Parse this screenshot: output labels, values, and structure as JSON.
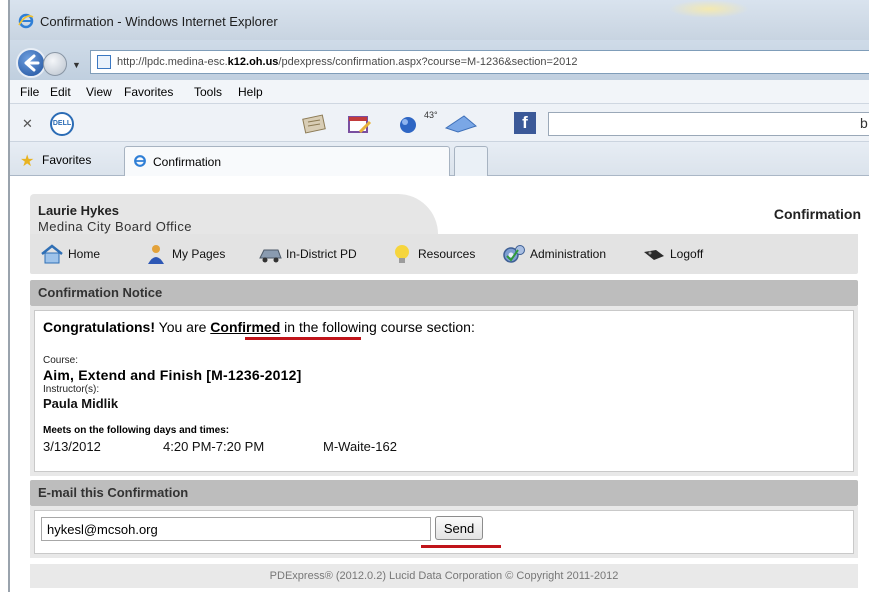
{
  "browser": {
    "window_title": "Confirmation - Windows Internet Explorer",
    "address_pre": "http://lpdc.medina-esc.",
    "address_bold": "k12.oh.us",
    "address_post": "/pdexpress/confirmation.aspx?course=M-1236&section=2012",
    "menu": [
      "File",
      "Edit",
      "View",
      "Favorites",
      "Tools",
      "Help"
    ],
    "weather_temp": "43°",
    "search_partial": "b",
    "favorites_label": "Favorites",
    "tab_label": "Confirmation"
  },
  "header": {
    "user_name": "Laurie Hykes",
    "organization": "Medina City Board Office",
    "page_title": "Confirmation"
  },
  "nav": {
    "items": [
      {
        "label": "Home",
        "icon": "home-icon"
      },
      {
        "label": "My Pages",
        "icon": "person-icon"
      },
      {
        "label": "In-District PD",
        "icon": "vehicle-icon"
      },
      {
        "label": "Resources",
        "icon": "lightbulb-icon"
      },
      {
        "label": "Administration",
        "icon": "gears-icon"
      },
      {
        "label": "Logoff",
        "icon": "logoff-icon"
      }
    ]
  },
  "notice": {
    "heading": "Confirmation Notice",
    "congrats_bold": "Congratulations!",
    "text_pre": " You are ",
    "confirmed": "Confirmed",
    "text_post": " in the following course section:",
    "course_label": "Course:",
    "course_name": "Aim, Extend and Finish [M-1236-2012]",
    "instructor_label": "Instructor(s):",
    "instructor_name": "Paula Midlik",
    "meets_label": "Meets on the following days and times:",
    "meet_date": "3/13/2012",
    "meet_time": "4:20 PM-7:20 PM",
    "meet_location": "M-Waite-162"
  },
  "email": {
    "heading": "E-mail this Confirmation",
    "value": "hykesl@mcsoh.org",
    "send_label": "Send"
  },
  "footer": {
    "text": "PDExpress® (2012.0.2) Lucid Data Corporation © Copyright 2011-2012"
  },
  "colors": {
    "annotation_red": "#c0141a",
    "panel_header_gray": "#bdbdbd"
  }
}
